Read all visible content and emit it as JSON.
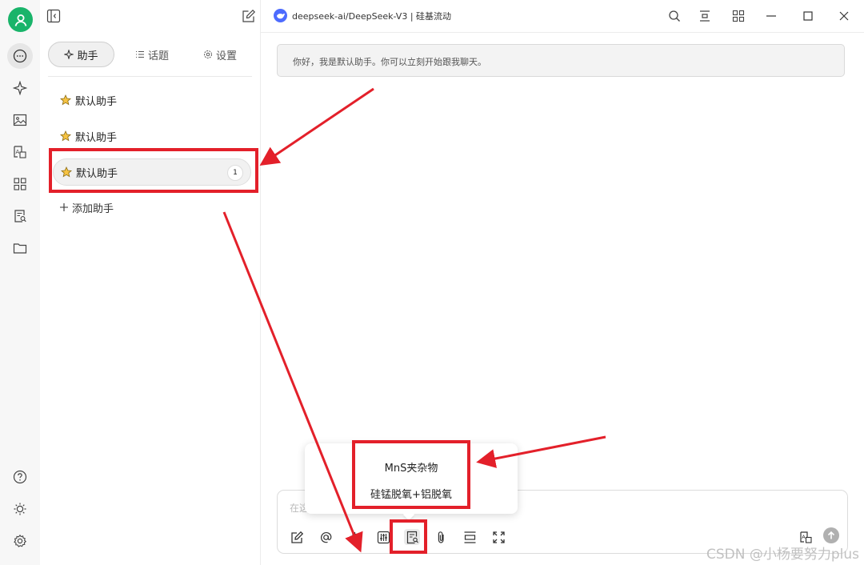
{
  "rail": {
    "items": [
      "chat-icon",
      "sparkle-icon",
      "image-icon",
      "translate-icon",
      "apps-icon",
      "knowledge-icon",
      "folder-icon"
    ],
    "bottom_items": [
      "help-icon",
      "theme-icon",
      "settings-icon"
    ]
  },
  "sidebar": {
    "tabs": [
      {
        "label": "助手",
        "icon": "sparkle-icon"
      },
      {
        "label": "话题",
        "icon": "list-icon"
      },
      {
        "label": "设置",
        "icon": "gear-icon"
      }
    ],
    "assistants": [
      {
        "name": "默认助手"
      },
      {
        "name": "默认助手"
      },
      {
        "name": "默认助手",
        "count": "1"
      }
    ],
    "add_label": "添加助手"
  },
  "header": {
    "model_title": "deepseek-ai/DeepSeek-V3 | 硅基流动"
  },
  "chat": {
    "greeting": "你好，我是默认助手。你可以立刻开始跟我聊天。",
    "input_placeholder": "在这"
  },
  "popup": {
    "items": [
      "MnS夹杂物",
      "硅锰脱氧+铝脱氧"
    ]
  },
  "watermark": "CSDN @小杨要努力plus",
  "colors": {
    "annotation_red": "#e3202a",
    "avatar_green": "#19b46a",
    "model_blue": "#4d6bfe"
  }
}
